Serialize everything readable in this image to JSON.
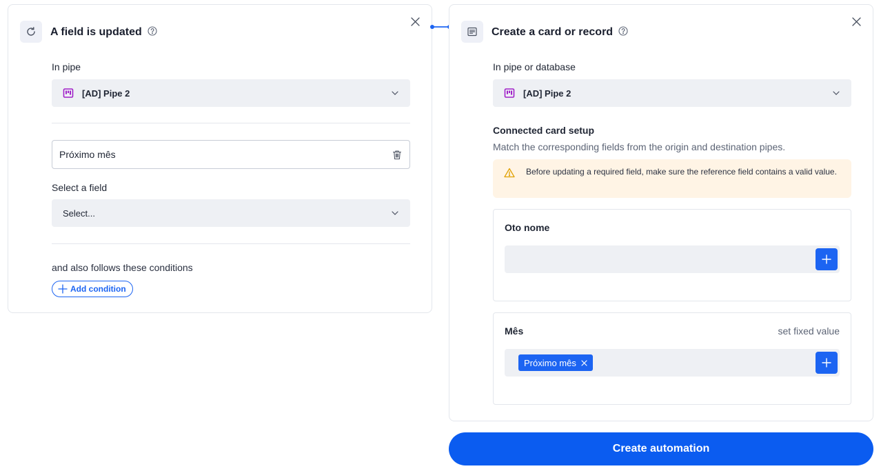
{
  "trigger": {
    "title": "A field is updated",
    "pipe_label": "In pipe",
    "pipe_value": "[AD] Pipe 2",
    "field_value": "Próximo mês",
    "select_label": "Select a field",
    "select_placeholder": "Select...",
    "conditions_text": "and also follows these conditions",
    "add_condition_label": "Add condition"
  },
  "action": {
    "title": "Create a card or record",
    "pipe_label": "In pipe or database",
    "pipe_value": "[AD] Pipe 2",
    "setup_title": "Connected card setup",
    "setup_desc": "Match the corresponding fields from the origin and destination pipes.",
    "warning": "Before updating a required field, make sure the reference field contains a valid value.",
    "fields": [
      {
        "label": "Oto nome",
        "right_label": "",
        "chip": ""
      },
      {
        "label": "Mês",
        "right_label": "set fixed value",
        "chip": "Próximo mês"
      }
    ]
  },
  "cta_label": "Create automation",
  "icons": {
    "trigger": "refresh-icon",
    "action": "card-icon",
    "help": "question-circle-icon",
    "close": "close-icon",
    "pipe": "pipe-icon",
    "chevron": "chevron-down-icon",
    "trash": "trash-icon",
    "warning": "warning-icon",
    "plus": "plus-icon"
  },
  "colors": {
    "accent": "#1c64f2",
    "cta": "#0b5cf0",
    "pipe_icon": "#a020c8",
    "warning_bg": "#fff4e5",
    "warning_icon": "#e0a000"
  }
}
